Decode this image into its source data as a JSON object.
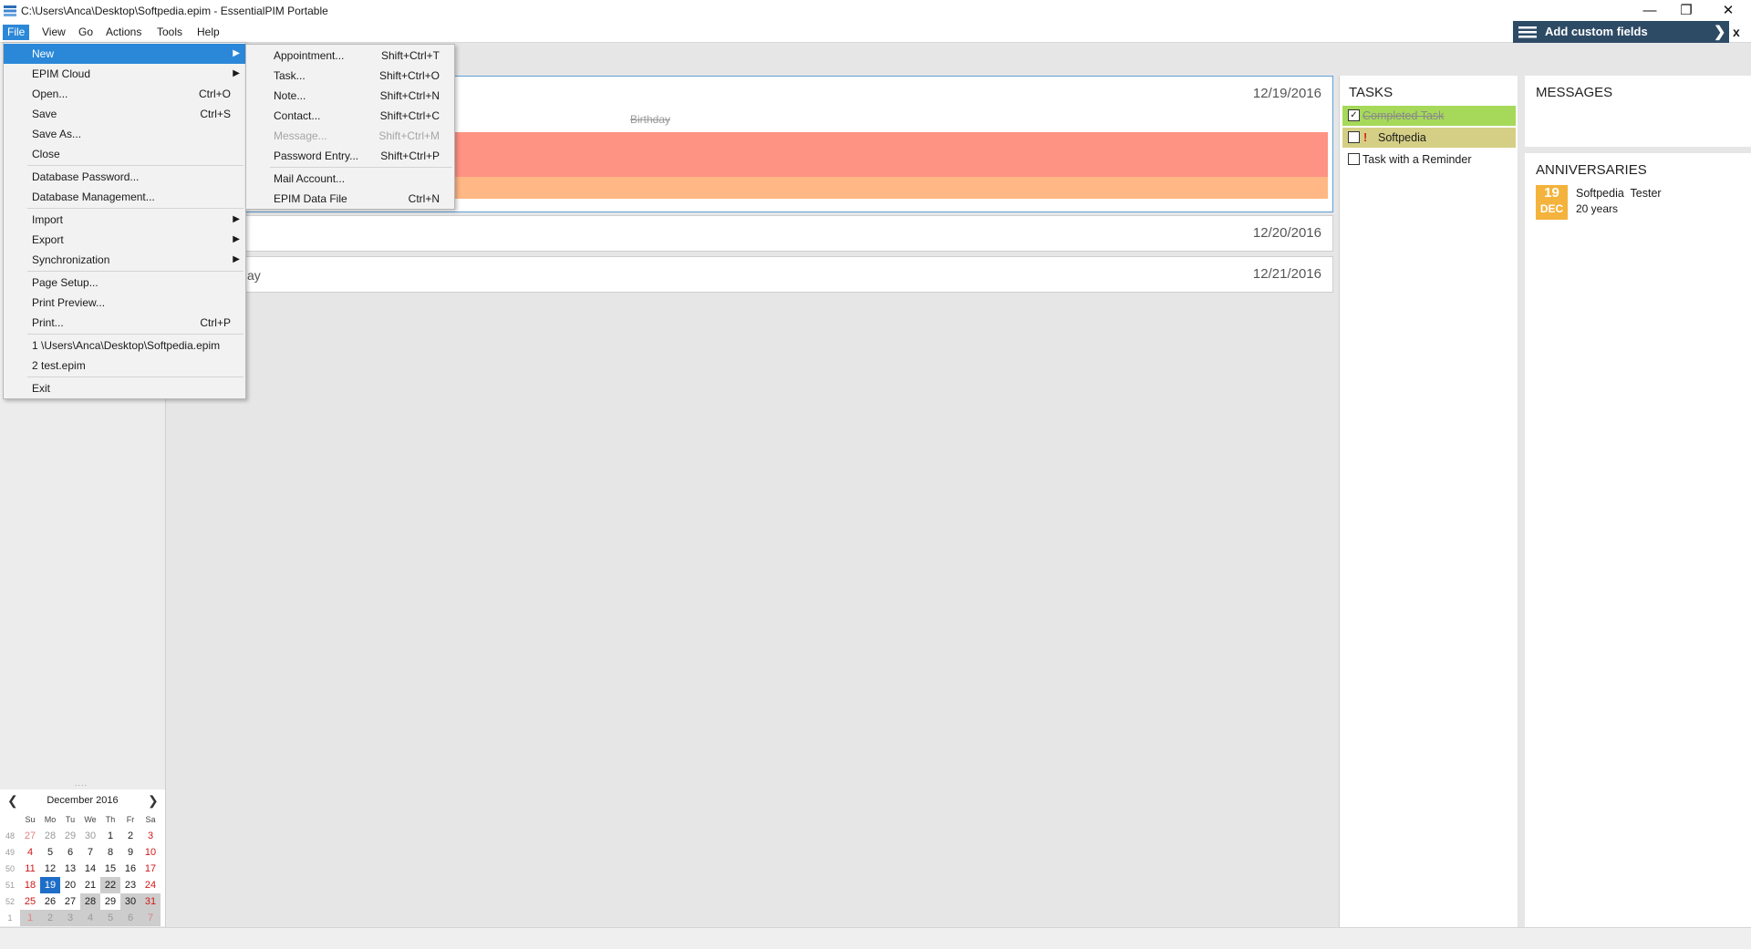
{
  "window": {
    "title": "C:\\Users\\Anca\\Desktop\\Softpedia.epim - EssentialPIM Portable",
    "minimize": "—",
    "restore": "❐",
    "close": "✕"
  },
  "menubar": {
    "items": [
      "File",
      "View",
      "Go",
      "Actions",
      "Tools",
      "Help"
    ],
    "active": "File"
  },
  "custom_fields": {
    "label": "Add custom fields",
    "arrow": "❯",
    "close": "x"
  },
  "file_menu": {
    "items": [
      {
        "label": "New",
        "shortcut": "",
        "submenu": true,
        "highlighted": true
      },
      {
        "label": "EPIM Cloud",
        "shortcut": "",
        "submenu": true
      },
      {
        "label": "Open...",
        "shortcut": "Ctrl+O"
      },
      {
        "label": "Save",
        "shortcut": "Ctrl+S"
      },
      {
        "label": "Save As...",
        "shortcut": ""
      },
      {
        "label": "Close",
        "shortcut": ""
      },
      {
        "label": "Database Password...",
        "shortcut": ""
      },
      {
        "label": "Database Management...",
        "shortcut": ""
      },
      {
        "label": "Import",
        "shortcut": "",
        "submenu": true
      },
      {
        "label": "Export",
        "shortcut": "",
        "submenu": true
      },
      {
        "label": "Synchronization",
        "shortcut": "",
        "submenu": true
      },
      {
        "label": "Page Setup...",
        "shortcut": ""
      },
      {
        "label": "Print Preview...",
        "shortcut": ""
      },
      {
        "label": "Print...",
        "shortcut": "Ctrl+P"
      },
      {
        "label": "1 \\Users\\Anca\\Desktop\\Softpedia.epim",
        "shortcut": ""
      },
      {
        "label": "2 test.epim",
        "shortcut": ""
      },
      {
        "label": "Exit",
        "shortcut": ""
      }
    ]
  },
  "new_submenu": {
    "items": [
      {
        "label": "Appointment...",
        "shortcut": "Shift+Ctrl+T"
      },
      {
        "label": "Task...",
        "shortcut": "Shift+Ctrl+O"
      },
      {
        "label": "Note...",
        "shortcut": "Shift+Ctrl+N"
      },
      {
        "label": "Contact...",
        "shortcut": "Shift+Ctrl+C"
      },
      {
        "label": "Message...",
        "shortcut": "Shift+Ctrl+M",
        "disabled": true
      },
      {
        "label": "Password Entry...",
        "shortcut": "Shift+Ctrl+P"
      },
      {
        "label": "Mail Account...",
        "shortcut": ""
      },
      {
        "label": "EPIM Data File",
        "shortcut": "Ctrl+N"
      }
    ]
  },
  "days": [
    {
      "date": "12/19/2016",
      "event_text": "Birthday"
    },
    {
      "date": "12/20/2016"
    },
    {
      "date": "12/21/2016",
      "fragment": "ay"
    }
  ],
  "tasks": {
    "title": "TASKS",
    "items": [
      {
        "label": "Completed Task",
        "checked": true,
        "color": "#a6d95a"
      },
      {
        "label": "Softpedia",
        "checked": false,
        "priority": "!",
        "color": "#d5cf86"
      },
      {
        "label": "Task with a Reminder",
        "checked": false
      }
    ]
  },
  "messages": {
    "title": "MESSAGES"
  },
  "anniversaries": {
    "title": "ANNIVERSARIES",
    "badge_day": "19",
    "badge_month": "DEC",
    "name": "Softpedia  Tester",
    "years": "20 years"
  },
  "mini_calendar": {
    "month": "December  2016",
    "prev": "❮",
    "next": "❯",
    "weekdays": [
      "Su",
      "Mo",
      "Tu",
      "We",
      "Th",
      "Fr",
      "Sa"
    ],
    "weeks": [
      {
        "wk": "48",
        "days": [
          "27",
          "28",
          "29",
          "30",
          "1",
          "2",
          "3"
        ]
      },
      {
        "wk": "49",
        "days": [
          "4",
          "5",
          "6",
          "7",
          "8",
          "9",
          "10"
        ]
      },
      {
        "wk": "50",
        "days": [
          "11",
          "12",
          "13",
          "14",
          "15",
          "16",
          "17"
        ]
      },
      {
        "wk": "51",
        "days": [
          "18",
          "19",
          "20",
          "21",
          "22",
          "23",
          "24"
        ]
      },
      {
        "wk": "52",
        "days": [
          "25",
          "26",
          "27",
          "28",
          "29",
          "30",
          "31"
        ]
      },
      {
        "wk": "1",
        "days": [
          "1",
          "2",
          "3",
          "4",
          "5",
          "6",
          "7"
        ]
      }
    ],
    "today": "19"
  },
  "colors": {
    "accent": "#2b88d8",
    "event_primary": "#fe9283",
    "event_secondary": "#feb785",
    "badge": "#f3b33c",
    "custom_fields_bg": "#2e4b66"
  }
}
